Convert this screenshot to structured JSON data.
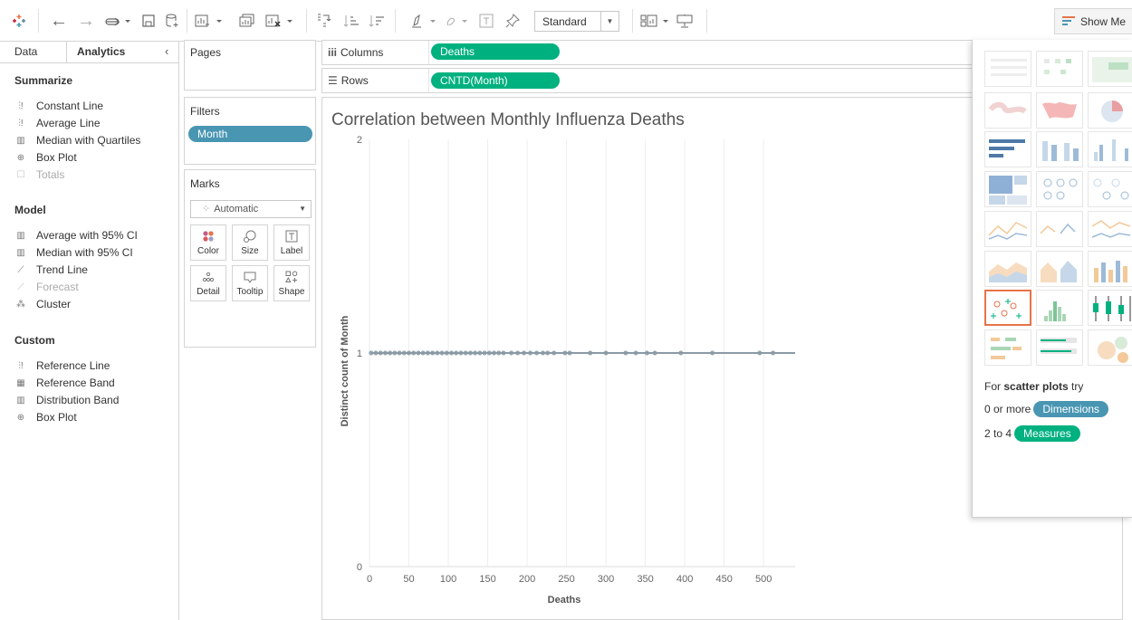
{
  "toolbar": {
    "view_mode": "Standard",
    "show_me_label": "Show Me"
  },
  "left_panel": {
    "tabs": [
      "Data",
      "Analytics"
    ],
    "active_tab": "Analytics",
    "sections": [
      {
        "title": "Summarize",
        "items": [
          {
            "label": "Constant Line",
            "icon": "reference-line-icon",
            "enabled": true
          },
          {
            "label": "Average Line",
            "icon": "reference-line-icon",
            "enabled": true
          },
          {
            "label": "Median with Quartiles",
            "icon": "distribution-band-icon",
            "enabled": true
          },
          {
            "label": "Box Plot",
            "icon": "box-plot-icon",
            "enabled": true
          },
          {
            "label": "Totals",
            "icon": "totals-icon",
            "enabled": false
          }
        ]
      },
      {
        "title": "Model",
        "items": [
          {
            "label": "Average with 95% CI",
            "icon": "distribution-band-icon",
            "enabled": true
          },
          {
            "label": "Median with 95% CI",
            "icon": "distribution-band-icon",
            "enabled": true
          },
          {
            "label": "Trend Line",
            "icon": "trend-line-icon",
            "enabled": true
          },
          {
            "label": "Forecast",
            "icon": "forecast-icon",
            "enabled": false
          },
          {
            "label": "Cluster",
            "icon": "cluster-icon",
            "enabled": true
          }
        ]
      },
      {
        "title": "Custom",
        "items": [
          {
            "label": "Reference Line",
            "icon": "reference-line-icon",
            "enabled": true
          },
          {
            "label": "Reference Band",
            "icon": "reference-band-icon",
            "enabled": true
          },
          {
            "label": "Distribution Band",
            "icon": "distribution-band-icon",
            "enabled": true
          },
          {
            "label": "Box Plot",
            "icon": "box-plot-icon",
            "enabled": true
          }
        ]
      }
    ]
  },
  "shelves": {
    "pages_label": "Pages",
    "filters_label": "Filters",
    "filter_pill": "Month",
    "marks_label": "Marks",
    "mark_type": "Automatic",
    "mark_buttons": [
      "Color",
      "Size",
      "Label",
      "Detail",
      "Tooltip",
      "Shape"
    ],
    "columns_label": "Columns",
    "columns_pill": "Deaths",
    "rows_label": "Rows",
    "rows_pill": "CNTD(Month)"
  },
  "viz": {
    "title": "Correlation between Monthly Influenza Deaths"
  },
  "chart_data": {
    "type": "scatter",
    "title": "Correlation between Monthly Influenza Deaths",
    "xlabel": "Deaths",
    "ylabel": "Distinct count of Month",
    "xlim": [
      0,
      540
    ],
    "ylim": [
      0,
      2
    ],
    "x_ticks": [
      0,
      50,
      100,
      150,
      200,
      250,
      300,
      350,
      400,
      450,
      500
    ],
    "y_ticks": [
      0,
      1,
      2
    ],
    "grid": true,
    "x": [
      2,
      8,
      14,
      20,
      26,
      32,
      38,
      44,
      50,
      56,
      62,
      68,
      74,
      80,
      86,
      92,
      98,
      104,
      110,
      116,
      122,
      128,
      134,
      140,
      146,
      152,
      158,
      164,
      170,
      180,
      188,
      196,
      204,
      212,
      220,
      226,
      234,
      248,
      254,
      280,
      300,
      325,
      338,
      352,
      362,
      395,
      435,
      495,
      512
    ],
    "y": [
      1,
      1,
      1,
      1,
      1,
      1,
      1,
      1,
      1,
      1,
      1,
      1,
      1,
      1,
      1,
      1,
      1,
      1,
      1,
      1,
      1,
      1,
      1,
      1,
      1,
      1,
      1,
      1,
      1,
      1,
      1,
      1,
      1,
      1,
      1,
      1,
      1,
      1,
      1,
      1,
      1,
      1,
      1,
      1,
      1,
      1,
      1,
      1,
      1
    ],
    "point_color": "#8a9aa5"
  },
  "show_me": {
    "hint_prefix": "For ",
    "hint_bold": "scatter plots",
    "hint_suffix": " try",
    "dim_prefix": "0 or more",
    "dim_pill": "Dimensions",
    "meas_prefix": "2 to 4",
    "meas_pill": "Measures",
    "selected": "scatter-plot"
  },
  "colors": {
    "dimension": "#4996b2",
    "measure": "#00b180",
    "accent": "#e8734a"
  }
}
